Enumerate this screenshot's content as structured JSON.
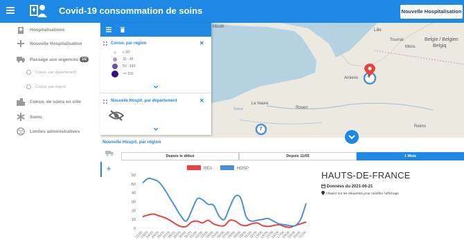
{
  "header": {
    "title": "Covid-19 consommation de soins",
    "button_label": "Nouvelle Hospitalisation",
    "color": "#1e88e5"
  },
  "sidebar": {
    "items": [
      {
        "label": "Hospitalisations",
        "icon": "hospital-icon"
      },
      {
        "label": "Nouvelle Hospitalisation",
        "icon": "plus-icon"
      },
      {
        "label": "Passage aux urgences",
        "icon": "ambulance-icon",
        "badge": "1/2"
      },
      {
        "label": "Conso. par département",
        "icon": "radio-icon"
      },
      {
        "label": "Conso. par région",
        "icon": "radio-icon"
      },
      {
        "label": "Conso. de soins en ville",
        "icon": "city-icon"
      },
      {
        "label": "Samu",
        "icon": "asterisk-icon"
      },
      {
        "label": "Limites administratives",
        "icon": "globe-icon"
      }
    ]
  },
  "map": {
    "labels": [
      "Lille",
      "Tournai",
      "Belgie / Belgien",
      "Belgiq",
      "Mons",
      "Amiens",
      "Le Havre",
      "Rouen",
      "Reims",
      "Seine",
      "Mouth"
    ],
    "markers": [
      {
        "label": "6"
      },
      {
        "label": "7"
      }
    ]
  },
  "panel": {
    "layer1": {
      "title": "Conso. par région",
      "legend": [
        "< 30",
        "30 - 49",
        "50 - 149",
        ">= 150"
      ]
    },
    "layer2": {
      "title": "Nouvelle Hospit. par département"
    }
  },
  "section": {
    "title": "Nouvelle Hospit. par région",
    "tabs": [
      "Depuis le début",
      "Depuis 11/05",
      "1 Mois"
    ],
    "active_tab": 2
  },
  "region": {
    "name": "HAUTS-DE-FRANCE",
    "date": "Données du 2021-06-21",
    "hint": "Cliquez sur les étiquettes pour modifier l'affichage"
  },
  "chart_data": {
    "type": "line",
    "title": "",
    "xlabel": "",
    "ylabel": "",
    "ylim": [
      0,
      60
    ],
    "yticks": [
      0,
      10,
      20,
      30,
      40,
      50,
      60
    ],
    "x": [
      "22/05",
      "23/05",
      "24/05",
      "25/05",
      "26/05",
      "27/05",
      "28/05",
      "29/05",
      "30/05",
      "31/05",
      "01/06",
      "02/06",
      "03/06",
      "04/06",
      "05/06",
      "06/06",
      "07/06",
      "08/06",
      "09/06",
      "10/06",
      "11/06",
      "12/06",
      "13/06",
      "14/06",
      "15/06",
      "16/06",
      "17/06",
      "18/06",
      "19/06",
      "20/06",
      "21/06"
    ],
    "series": [
      {
        "name": "REA",
        "color": "#e8423f",
        "values": [
          13,
          15,
          16,
          14,
          12,
          9,
          5,
          2,
          2,
          7,
          8,
          6,
          9,
          5,
          3,
          3,
          9,
          8,
          4,
          3,
          5,
          6,
          3,
          2,
          3,
          4,
          2,
          1,
          3,
          5,
          7
        ]
      },
      {
        "name": "HOSP",
        "color": "#4a90d9",
        "values": [
          51,
          56,
          55,
          52,
          44,
          34,
          24,
          14,
          8,
          20,
          33,
          32,
          27,
          26,
          14,
          10,
          24,
          36,
          34,
          13,
          8,
          9,
          10,
          11,
          8,
          5,
          4,
          3,
          3,
          10,
          28
        ]
      }
    ],
    "legend": "top",
    "grid": false
  }
}
